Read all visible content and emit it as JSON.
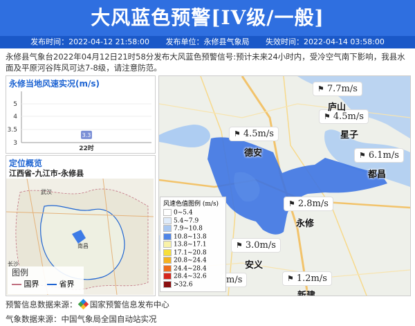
{
  "header": {
    "title": "大风蓝色预警[IV级/一般]",
    "issue_time": "发布时间：2022-04-12 21:58:00",
    "issuer": "发布单位：永修县气象局",
    "expire_time": "失效时间：2022-04-14 03:58:00"
  },
  "description": "永修县气象台2022年04月12日21时58分发布大风蓝色预警信号:预计未来24小时内，受冷空气南下影响，我县水面及平原河谷阵风可达7-8级，请注意防范。",
  "wind_panel": {
    "title": "永修当地风速实况(m/s)",
    "chart_data": {
      "type": "scatter",
      "categories": [
        "22时"
      ],
      "values": [
        3.3
      ],
      "data_labels": [
        "3.3"
      ],
      "y_ticks": [
        "5",
        "4",
        "3.5",
        "3"
      ],
      "ylim": [
        3,
        5
      ]
    }
  },
  "location_panel": {
    "title": "定位概览",
    "path": "江西省-九江市-永修县",
    "map_labels": [
      "武汉",
      "南昌",
      "长沙"
    ],
    "legend_title": "图例",
    "legend_items": [
      {
        "label": "国界",
        "color": "#c07080"
      },
      {
        "label": "省界",
        "color": "#1e64d2"
      }
    ]
  },
  "map": {
    "stations": [
      {
        "value": "7.7m/s"
      },
      {
        "value": "4.5m/s"
      },
      {
        "value": "4.5m/s"
      },
      {
        "value": "6.1m/s"
      },
      {
        "value": "2.8m/s"
      },
      {
        "value": "3.0m/s"
      },
      {
        "value": "1.2m/s"
      },
      {
        "value": "m/s"
      }
    ],
    "places": [
      "庐山",
      "星子",
      "德安",
      "都昌",
      "永修",
      "安义",
      "新建"
    ],
    "legend": {
      "title": "风速色值图例 (m/s)",
      "items": [
        {
          "label": "0~5.4",
          "color": "#ffffff"
        },
        {
          "label": "5.4~7.9",
          "color": "#e0ecfb"
        },
        {
          "label": "7.9~10.8",
          "color": "#a9c8f2"
        },
        {
          "label": "10.8~13.8",
          "color": "#4f85e6"
        },
        {
          "label": "13.8~17.1",
          "color": "#f9f2a8"
        },
        {
          "label": "17.1~20.8",
          "color": "#f7df3b"
        },
        {
          "label": "20.8~24.4",
          "color": "#f5b321"
        },
        {
          "label": "24.4~28.4",
          "color": "#ee6d1e"
        },
        {
          "label": "28.4~32.6",
          "color": "#d6261d"
        },
        {
          "label": ">32.6",
          "color": "#8b0f0f"
        }
      ]
    }
  },
  "footer": {
    "warning_source": "预警信息数据来源：",
    "warning_source_name": "国家预警信息发布中心",
    "weather_source": "气象数据来源：中国气象局全国自动站实况"
  }
}
